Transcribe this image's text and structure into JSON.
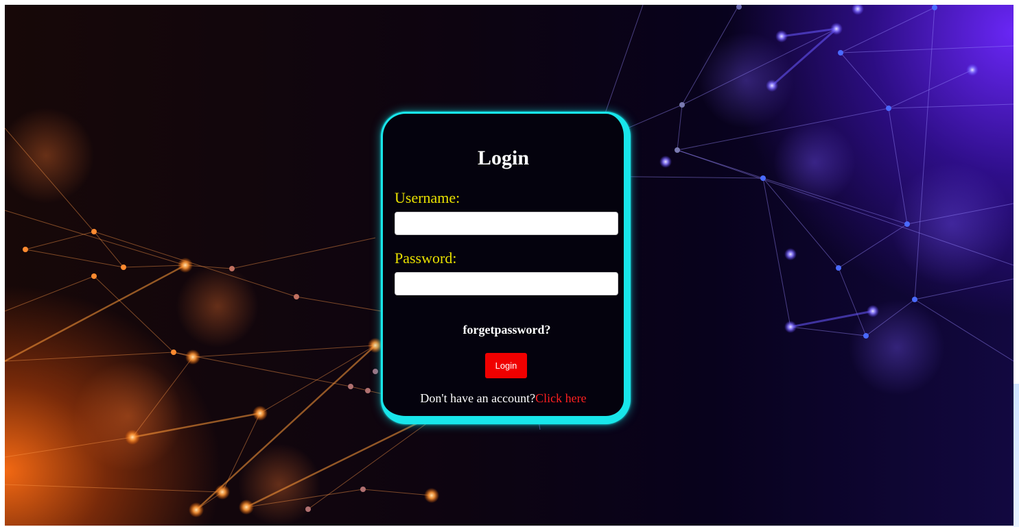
{
  "form": {
    "title": "Login",
    "username_label": "Username:",
    "username_value": "",
    "password_label": "Password:",
    "password_value": "",
    "forgot_link": "forgetpassword?",
    "login_button": "Login",
    "signup_prompt": "Don't have an account?",
    "signup_link": "Click here"
  },
  "colors": {
    "card_border": "#18e6ea",
    "label": "#e8e000",
    "button": "#f00000",
    "link": "#ff2020"
  }
}
